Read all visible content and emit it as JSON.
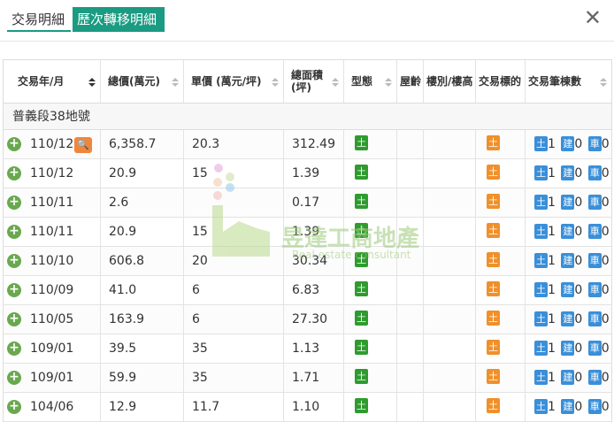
{
  "tabs": [
    "交易明細",
    "歷次轉移明細"
  ],
  "close_symbol": "✕",
  "headers": [
    "交易年/月",
    "總價(萬元)",
    "單價 (萬元/坪)",
    "總面積\n(坪)",
    "型態",
    "屋齡",
    "樓別/樓高",
    "交易標的",
    "交易筆棟數"
  ],
  "group_title": "普義段38地號",
  "watermark": {
    "cn": "昱達工商地產",
    "en": "Real estate consultant"
  },
  "tag_labels": {
    "land": "土",
    "build": "建",
    "car": "車"
  },
  "rows": [
    {
      "date": "110/12",
      "total": "6,358.7",
      "unit": "20.3",
      "area": "312.49",
      "land": "1",
      "build": "0",
      "car": "0"
    },
    {
      "date": "110/12",
      "total": "20.9",
      "unit": "15",
      "area": "1.39",
      "land": "1",
      "build": "0",
      "car": "0"
    },
    {
      "date": "110/11",
      "total": "2.6",
      "unit": "",
      "area": "0.17",
      "land": "1",
      "build": "0",
      "car": "0"
    },
    {
      "date": "110/11",
      "total": "20.9",
      "unit": "15",
      "area": "1.39",
      "land": "1",
      "build": "0",
      "car": "0"
    },
    {
      "date": "110/10",
      "total": "606.8",
      "unit": "20",
      "area": "30.34",
      "land": "1",
      "build": "0",
      "car": "0"
    },
    {
      "date": "110/09",
      "total": "41.0",
      "unit": "6",
      "area": "6.83",
      "land": "1",
      "build": "0",
      "car": "0"
    },
    {
      "date": "110/05",
      "total": "163.9",
      "unit": "6",
      "area": "27.30",
      "land": "1",
      "build": "0",
      "car": "0"
    },
    {
      "date": "109/01",
      "total": "39.5",
      "unit": "35",
      "area": "1.13",
      "land": "1",
      "build": "0",
      "car": "0"
    },
    {
      "date": "109/01",
      "total": "59.9",
      "unit": "35",
      "area": "1.71",
      "land": "1",
      "build": "0",
      "car": "0"
    },
    {
      "date": "104/06",
      "total": "12.9",
      "unit": "11.7",
      "area": "1.10",
      "land": "1",
      "build": "0",
      "car": "0"
    }
  ]
}
